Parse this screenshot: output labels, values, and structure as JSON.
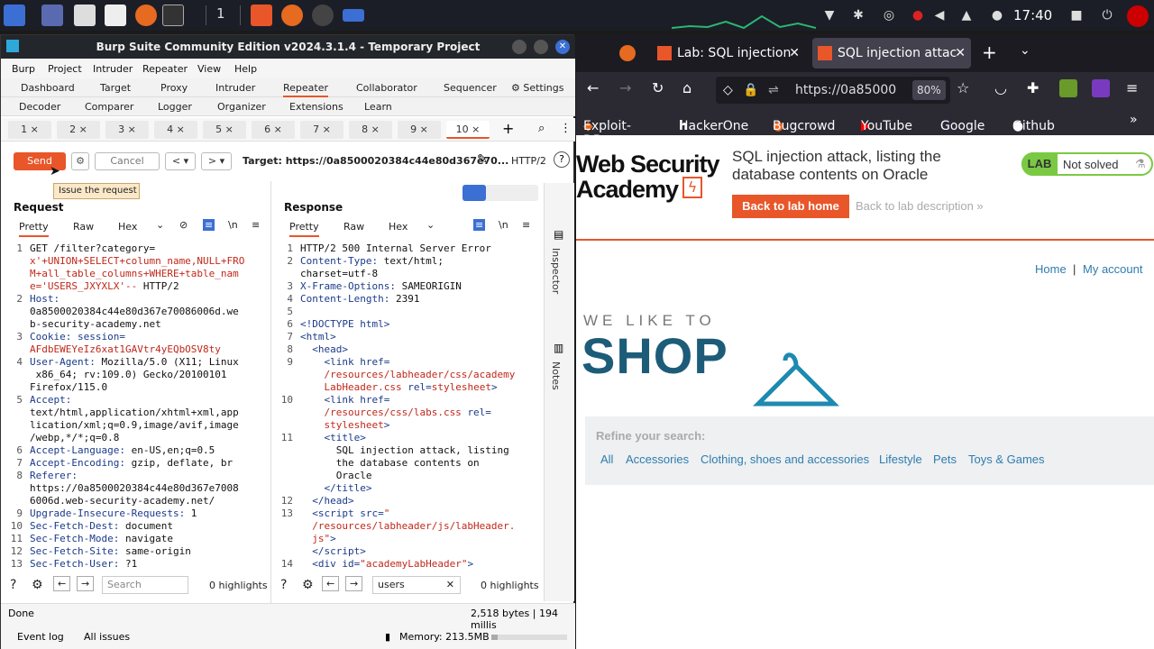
{
  "taskbar": {
    "workspace": "1",
    "clock": "17:40"
  },
  "burp": {
    "title": "Burp Suite Community Edition v2024.3.1.4 - Temporary Project",
    "menu": [
      "Burp",
      "Project",
      "Intruder",
      "Repeater",
      "View",
      "Help"
    ],
    "tabs1": [
      "Dashboard",
      "Target",
      "Proxy",
      "Intruder",
      "Repeater",
      "Collaborator",
      "Sequencer",
      "Settings"
    ],
    "tabs2": [
      "Decoder",
      "Comparer",
      "Logger",
      "Organizer",
      "Extensions",
      "Learn"
    ],
    "numtabs": [
      "1 ×",
      "2 ×",
      "3 ×",
      "4 ×",
      "5 ×",
      "6 ×",
      "7 ×",
      "8 ×",
      "9 ×",
      "10 ×"
    ],
    "send": "Send",
    "cancel": "Cancel",
    "target": "Target: https://0a8500020384c44e80d367e70...",
    "protocol": "HTTP/2",
    "tooltip": "Issue the request",
    "request": {
      "header": "Request",
      "subtabs": [
        "Pretty",
        "Raw",
        "Hex"
      ]
    },
    "response": {
      "header": "Response",
      "subtabs": [
        "Pretty",
        "Raw",
        "Hex"
      ]
    },
    "side": [
      "Inspector",
      "Notes"
    ],
    "req_search_placeholder": "Search",
    "req_highlights": "0 highlights",
    "resp_search": "users",
    "resp_highlights": "0 highlights",
    "status": "Done",
    "bytes": "2,518 bytes | 194 millis",
    "event_log": "Event log",
    "all_issues": "All issues",
    "memory": "Memory: 213.5MB"
  },
  "firefox": {
    "tab1": "Lab: SQL injection",
    "tab2": "SQL injection attac",
    "url": "https://0a85000",
    "zoom": "80%",
    "bookmarks": [
      "Exploit-DB",
      "HackerOne",
      "Bugcrowd",
      "YouTube",
      "Google",
      "Github"
    ],
    "logo1": "Web Security",
    "logo2": "Academy",
    "lab_title": "SQL injection attack, listing the database contents on Oracle",
    "back_btn": "Back to lab home",
    "back_desc": "Back to lab description",
    "lab": "LAB",
    "lab_status": "Not solved",
    "home": "Home",
    "sep": "|",
    "account": "My account",
    "shop_small": "WE LIKE TO",
    "shop_big": "SHOP",
    "refine": "Refine your search:",
    "filters": [
      "All",
      "Accessories",
      "Clothing, shoes and accessories",
      "Lifestyle",
      "Pets",
      "Toys & Games"
    ]
  }
}
